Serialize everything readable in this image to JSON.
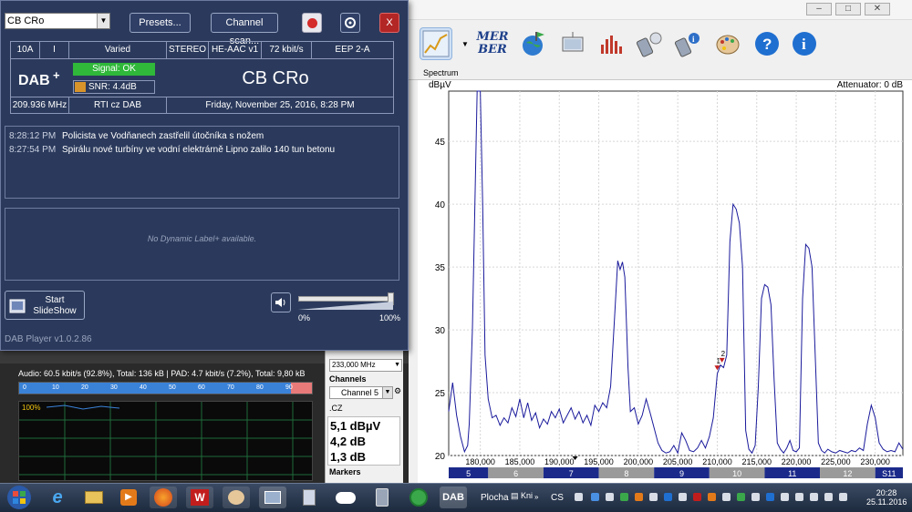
{
  "dab_player": {
    "station_selected": "CB CRo",
    "presets_label": "Presets...",
    "channel_scan_label": "Channel scan...",
    "close_label": "X",
    "info": {
      "block": "10A",
      "type": "I",
      "genre": "Varied",
      "mode": "STEREO",
      "codec": "HE-AAC v1",
      "bitrate": "72 kbit/s",
      "protection": "EEP 2-A",
      "signal": "Signal: OK",
      "snr": "SNR: 4.4dB",
      "station_name": "CB CRo",
      "frequency": "209.936 MHz",
      "ensemble": "RTI cz DAB",
      "datetime": "Friday, November 25, 2016, 8:28 PM"
    },
    "news": [
      {
        "time": "8:28:12 PM",
        "text": "Policista ve Vodňanech zastřelil útočníka s nožem"
      },
      {
        "time": "8:27:54 PM",
        "text": "Spirálu nové turbíny ve vodní elektrárně Lipno zalilo 140 tun betonu"
      }
    ],
    "dynamic_label_placeholder": "No Dynamic Label+ available.",
    "slideshow_label_1": "Start",
    "slideshow_label_2": "SlideShow",
    "volume_min": "0%",
    "volume_max": "100%",
    "volume_level": 1.0,
    "version": "DAB Player v1.0.2.86"
  },
  "background_app": {
    "audio_line": "Audio: 60.5 kbit/s (92.8%), Total: 136 kB | PAD: 4.7 kbit/s (7.2%), Total: 9,80 kB",
    "scale_ticks": [
      "0",
      "10",
      "20",
      "30",
      "40",
      "50",
      "60",
      "70",
      "80",
      "90"
    ],
    "audio_fill": 0.928,
    "graph_label": "100%"
  },
  "mid_panel": {
    "frequency_value": "233,000 MHz",
    "channels_label": "Channels",
    "channel_value": "Channel 5",
    "country": ".CZ",
    "reading_1": "5,1 dBµV",
    "reading_2": "4,2 dB",
    "reading_3": "1,3 dB",
    "markers_label": "Markers"
  },
  "spectrum_app": {
    "tab_label": "Spectrum",
    "y_unit": "dBµV",
    "attenuator": "Attenuator: 0 dB",
    "toolbar": {
      "merber_1": "MER",
      "merber_2": "BER"
    },
    "marker_labels": [
      "1",
      "2"
    ]
  },
  "chart_data": {
    "type": "line",
    "xlabel": "",
    "ylabel": "dBµV",
    "xlim": [
      176000,
      233500
    ],
    "ylim": [
      20,
      49
    ],
    "x_ticks": [
      "180,000",
      "185,000",
      "190,000",
      "195,000",
      "200,000",
      "205,000",
      "210,000",
      "215,000",
      "220,000",
      "225,000",
      "230,000"
    ],
    "x_tick_values": [
      180000,
      185000,
      190000,
      195000,
      200000,
      205000,
      210000,
      215000,
      220000,
      225000,
      230000
    ],
    "y_ticks": [
      "20",
      "25",
      "30",
      "35",
      "40",
      "45"
    ],
    "y_tick_values": [
      20,
      25,
      30,
      35,
      40,
      45
    ],
    "channel_band": [
      {
        "label": "5",
        "from": 176000,
        "to": 181000
      },
      {
        "label": "6",
        "from": 181000,
        "to": 188000
      },
      {
        "label": "7",
        "from": 188000,
        "to": 195000
      },
      {
        "label": "8",
        "from": 195000,
        "to": 202000
      },
      {
        "label": "9",
        "from": 202000,
        "to": 209000
      },
      {
        "label": "10",
        "from": 209000,
        "to": 216000
      },
      {
        "label": "11",
        "from": 216000,
        "to": 223000
      },
      {
        "label": "12",
        "from": 223000,
        "to": 230000
      },
      {
        "label": "S11",
        "from": 230000,
        "to": 233500
      }
    ],
    "series": [
      {
        "color": "#1a1a9c",
        "x": [
          176000,
          176500,
          177000,
          177500,
          178000,
          178400,
          178600,
          179000,
          179600,
          180000,
          180300,
          180600,
          181000,
          181500,
          182000,
          182500,
          183000,
          183500,
          184000,
          184500,
          185000,
          185500,
          186000,
          186500,
          187000,
          187500,
          188000,
          188500,
          189000,
          189500,
          190000,
          190500,
          191000,
          191500,
          192000,
          192500,
          193000,
          193500,
          194000,
          194500,
          195000,
          195500,
          196000,
          196500,
          197000,
          197400,
          197700,
          198000,
          198300,
          198700,
          199000,
          199500,
          200000,
          200500,
          201000,
          201500,
          202000,
          202500,
          203000,
          203500,
          204000,
          204500,
          205000,
          205500,
          206000,
          206500,
          207000,
          207500,
          208000,
          208500,
          209000,
          209500,
          210000,
          210400,
          210800,
          211200,
          211600,
          212000,
          212400,
          212800,
          213200,
          213600,
          214000,
          214400,
          214800,
          215200,
          215600,
          216000,
          216400,
          216800,
          217200,
          217600,
          218000,
          218400,
          218800,
          219200,
          219600,
          220000,
          220400,
          220800,
          221200,
          221600,
          222000,
          222400,
          222800,
          223200,
          223600,
          224000,
          224500,
          225000,
          225500,
          226000,
          226500,
          227000,
          227500,
          228000,
          228500,
          229000,
          229500,
          230000,
          230500,
          231000,
          231500,
          232000,
          232500,
          233000,
          233500
        ],
        "y": [
          23.5,
          25.8,
          23.2,
          21.5,
          20.3,
          20.8,
          22.5,
          30,
          49,
          49,
          40,
          28,
          24.5,
          23,
          23.2,
          22.4,
          23,
          22.6,
          23.8,
          23.1,
          24.5,
          23,
          24.2,
          22.8,
          23.4,
          22.2,
          22.9,
          22.5,
          23.5,
          23,
          23.7,
          22.6,
          23.2,
          23.8,
          22.9,
          23.5,
          22.6,
          23.2,
          22.4,
          24,
          23.5,
          24.2,
          23.8,
          25.5,
          31,
          35.5,
          34.8,
          35.4,
          34.2,
          27,
          23.5,
          23.8,
          22.5,
          23.2,
          24.5,
          23.4,
          22.2,
          21,
          20.4,
          20.2,
          20.3,
          20.8,
          20.2,
          21.8,
          21.2,
          20.4,
          20.3,
          20.6,
          21.2,
          20.6,
          21.5,
          23,
          26.5,
          27.2,
          27,
          28,
          37,
          40,
          39.6,
          38.5,
          35,
          22,
          20.5,
          20.2,
          20.8,
          25.5,
          32.5,
          33.6,
          33.4,
          32,
          26,
          21,
          20.5,
          20.2,
          20.6,
          21.2,
          20.4,
          20.3,
          20.6,
          32.5,
          36.8,
          36.5,
          35,
          28,
          21,
          20.4,
          20.2,
          20.5,
          20.3,
          20.2,
          20.4,
          20.3,
          20.2,
          20.4,
          20.3,
          20.6,
          20.4,
          22.5,
          24,
          23,
          21,
          20.5,
          20.3,
          20.4,
          20.3,
          21,
          20.5
        ]
      }
    ],
    "markers": [
      {
        "label": "1",
        "x": 210000,
        "y": 26.8
      },
      {
        "label": "2",
        "x": 210600,
        "y": 27.4
      }
    ],
    "grid": true
  },
  "taskbar": {
    "plocha": "Plocha",
    "kni": "Kni",
    "lang": "CS",
    "time": "20:28",
    "date": "25.11.2016"
  },
  "colors": {
    "dab_bg": "#2b3a5c",
    "signal_ok": "#2fb83a",
    "snr_swatch": "#d8932a",
    "trace": "#1a1a9c",
    "channel_dark": "#1b2a8a",
    "channel_light": "#9a9a9a"
  }
}
